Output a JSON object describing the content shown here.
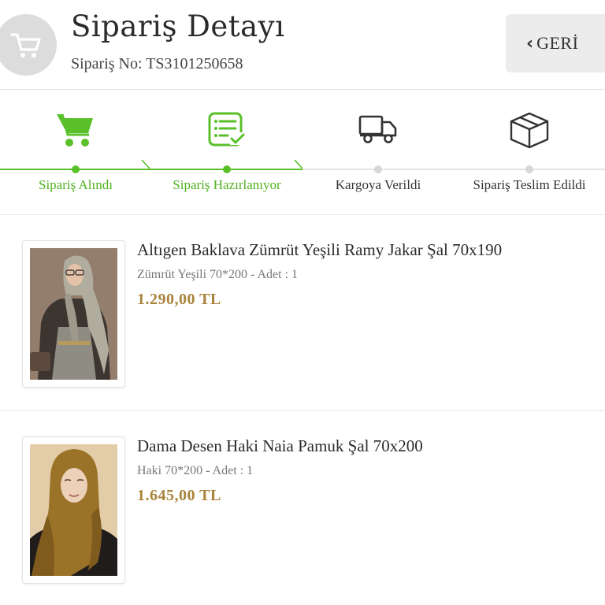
{
  "header": {
    "title": "Sipariş Detayı",
    "order_no": "Sipariş No: TS3101250658",
    "back_label": "GERİ",
    "cart_icon": "shopping-cart-icon"
  },
  "progress": {
    "accent_color": "#5ac02a",
    "steps": [
      {
        "label": "Sipariş Alındı",
        "icon": "shopping-cart-icon",
        "status": "done"
      },
      {
        "label": "Sipariş Hazırlanıyor",
        "icon": "checklist-icon",
        "status": "done"
      },
      {
        "label": "Kargoya Verildi",
        "icon": "truck-icon",
        "status": "pending"
      },
      {
        "label": "Sipariş Teslim Edildi",
        "icon": "box-icon",
        "status": "pending"
      }
    ]
  },
  "products": [
    {
      "name": "Altıgen Baklava Zümrüt Yeşili Ramy Jakar Şal 70x190",
      "variant": "Zümrüt Yeşili 70*200 - Adet : 1",
      "price": "1.290,00 TL"
    },
    {
      "name": "Dama Desen Haki Naia Pamuk Şal 70x200",
      "variant": "Haki 70*200 - Adet : 1",
      "price": "1.645,00 TL"
    }
  ],
  "colors": {
    "price": "#a8843c",
    "done": "#5ac02a",
    "pending": "#d6d6d6"
  }
}
